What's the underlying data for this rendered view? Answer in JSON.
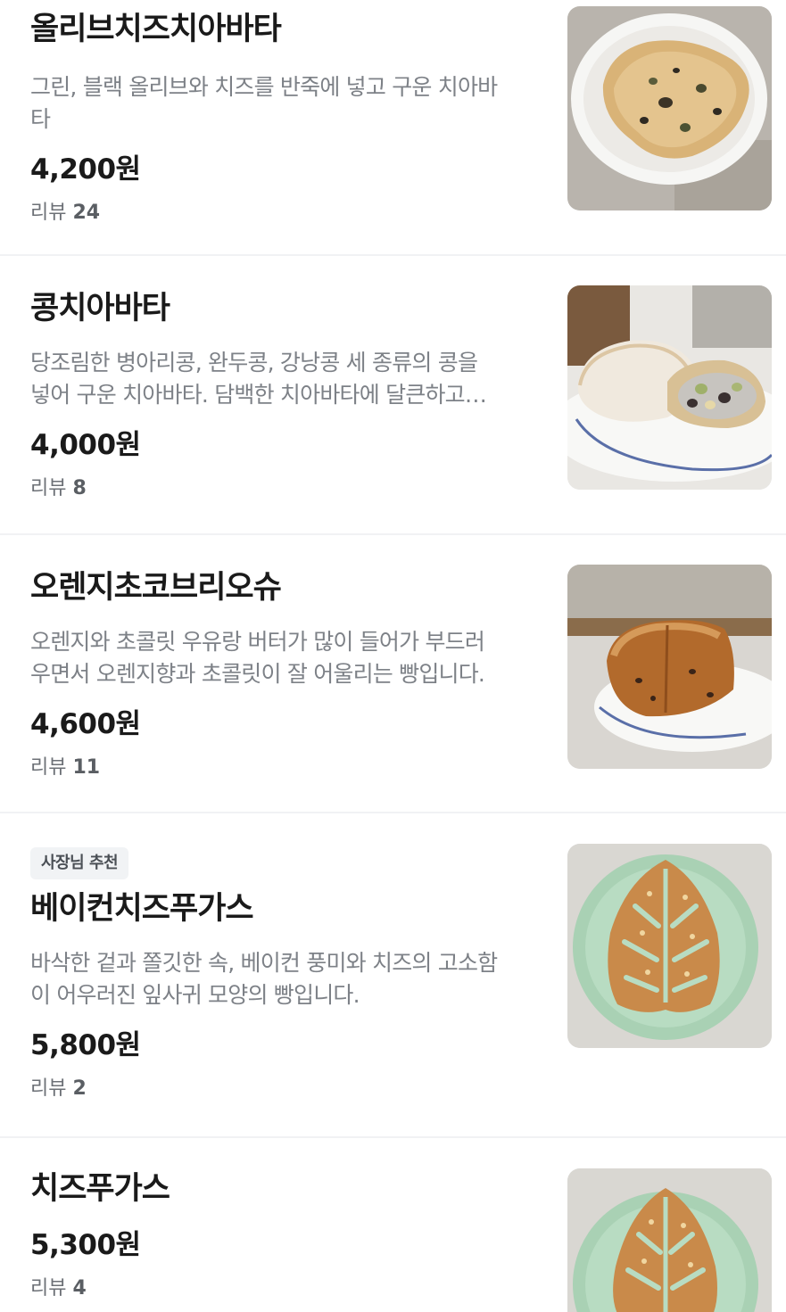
{
  "menu": {
    "items": [
      {
        "title": "올리브치즈치아바타",
        "description_lines": [
          "그린, 블랙 올리브와 치즈를 반죽에 넣고 구운 치아바",
          "타"
        ],
        "price": "4,200원",
        "review_label": "리뷰",
        "review_count": "24",
        "image": "olive-cheese-ciabatta-photo"
      },
      {
        "title": "콩치아바타",
        "description_lines": [
          "당조림한 병아리콩, 완두콩, 강낭콩 세 종류의 콩을",
          "넣어 구운 치아바타. 담백한 치아바타에 달큰하고…"
        ],
        "price": "4,000원",
        "review_label": "리뷰",
        "review_count": "8",
        "image": "bean-ciabatta-photo"
      },
      {
        "title": "오렌지초코브리오슈",
        "description_lines": [
          "오렌지와 초콜릿 우유랑 버터가 많이 들어가 부드러",
          "우면서 오렌지향과 초콜릿이 잘 어울리는 빵입니다."
        ],
        "price": "4,600원",
        "review_label": "리뷰",
        "review_count": "11",
        "image": "orange-choco-brioche-photo"
      },
      {
        "badge": "사장님 추천",
        "title": "베이컨치즈푸가스",
        "description_lines": [
          "바삭한 겉과 쫄깃한 속, 베이컨 풍미와 치즈의 고소함",
          "이 어우러진 잎사귀 모양의 빵입니다."
        ],
        "price": "5,800원",
        "review_label": "리뷰",
        "review_count": "2",
        "image": "bacon-cheese-fougasse-photo"
      },
      {
        "title": "치즈푸가스",
        "price": "5,300원",
        "review_label": "리뷰",
        "review_count": "4",
        "image": "cheese-fougasse-photo"
      }
    ]
  },
  "colors": {
    "title": "#1a1a1a",
    "description": "#7d8187",
    "review": "#6c7076",
    "badge_bg": "#f1f3f5",
    "separator": "#f1f2f4"
  }
}
